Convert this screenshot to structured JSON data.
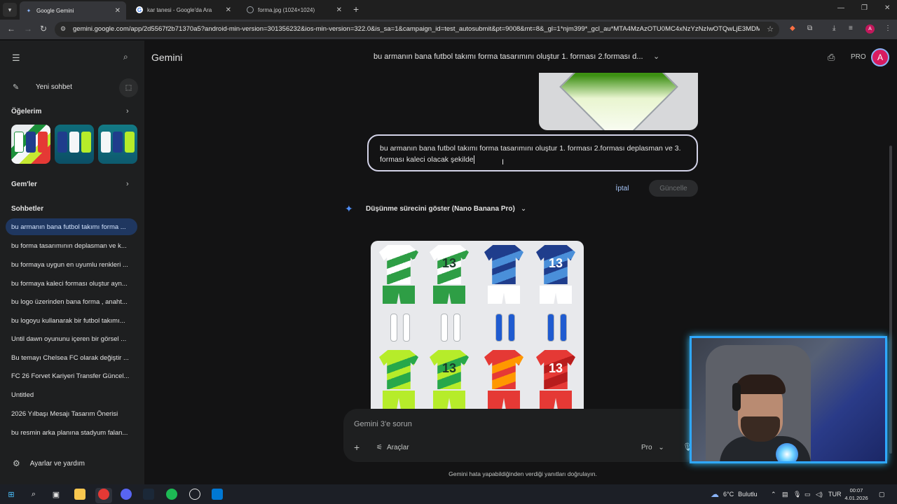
{
  "browser": {
    "tabs": [
      {
        "title": "Google Gemini",
        "active": true,
        "icon": "gemini-icon"
      },
      {
        "title": "kar tanesi - Google'da Ara",
        "active": false,
        "icon": "google-icon"
      },
      {
        "title": "forma.jpg (1024×1024)",
        "active": false,
        "icon": "globe-icon"
      }
    ],
    "url": "gemini.google.com/app/2d5567f2b71370a5?android-min-version=301356232&ios-min-version=322.0&is_sa=1&campaign_id=test_autosubmit&pt=9008&mt=8&_gl=1*njm399*_gcl_au*MTA4MzAzOTU0MC4xNzYzNzIwOTQwLjE3MDM5...",
    "profile_initial": "A"
  },
  "sidebar": {
    "new_chat_label": "Yeni sohbet",
    "items_heading": "Öğelerim",
    "gems_heading": "Gem'ler",
    "chats_heading": "Sohbetler",
    "chats": [
      "bu armanın bana futbol takımı forma ...",
      "bu forma tasarımının deplasman ve k...",
      "bu formaya uygun en uyumlu renkleri ...",
      "bu formaya kaleci forması oluştur ayn...",
      "bu logo üzerinden bana forma , anaht...",
      "bu logoyu kullanarak bir futbol takımı...",
      "Until dawn oyununu içeren bir görsel ...",
      "Bu temayı Chelsea FC olarak değiştir ...",
      "FC 26 Forvet Kariyeri Transfer Güncel...",
      "Untitled",
      "2026 Yılbaşı Mesajı Tasarım Önerisi",
      "bu resmin arka planına stadyum falan..."
    ],
    "settings_label": "Ayarlar ve yardım"
  },
  "header": {
    "brand": "Gemini",
    "conversation_title": "bu armanın bana futbol takımı forma tasarımını oluştur 1. forması 2.forması d...",
    "plan_label": "PRO",
    "avatar_initial": "A"
  },
  "edit": {
    "text": "bu armanın bana futbol takımı forma tasarımını oluştur 1. forması 2.forması deplasman ve 3. forması kaleci olacak şekilde",
    "cancel_label": "İptal",
    "update_label": "Güncelle"
  },
  "response": {
    "thinking_label": "Düşünme sürecini göster (Nano Banana Pro)",
    "kit_number": "13",
    "kits": [
      {
        "shirt": "#ffffff",
        "pattern": "#2e9e45",
        "num_color": "#1b6b2c",
        "shorts": "#2e9e45"
      },
      {
        "shirt": "#ffffff",
        "pattern": "#2e9e45",
        "num_color": "#1b3b2a",
        "shorts": "#2e9e45"
      },
      {
        "shirt": "#1f3d8c",
        "pattern": "#4a8fd9",
        "num_color": "#ffffff",
        "shorts": "#ffffff"
      },
      {
        "shirt": "#1f3d8c",
        "pattern": "#4a8fd9",
        "num_color": "#ffffff",
        "shorts": "#ffffff"
      },
      {
        "shirt": "#b6ec2a",
        "pattern": "#27a84a",
        "num_color": "#1b3b2a",
        "shorts": "#b6ec2a"
      },
      {
        "shirt": "#b6ec2a",
        "pattern": "#27a84a",
        "num_color": "#1b3b2a",
        "shorts": "#b6ec2a"
      },
      {
        "shirt": "#e53935",
        "pattern": "#ff9800",
        "num_color": "#ffffff",
        "shorts": "#e53935"
      },
      {
        "shirt": "#e53935",
        "pattern": "#b71c1c",
        "num_color": "#ffffff",
        "shorts": "#e53935"
      }
    ]
  },
  "composer": {
    "placeholder": "Gemini 3'e sorun",
    "tools_label": "Araçlar",
    "model_label": "Pro",
    "disclaimer": "Gemini hata yapabildiğinden verdiği yanıtları doğrulayın."
  },
  "taskbar": {
    "temperature": "6°C",
    "condition": "Bulutlu",
    "language": "TUR",
    "time": "00:07",
    "date": "4.01.2026"
  },
  "colors": {
    "accent": "#a8c7fa",
    "active_chat_bg": "#1f3760",
    "background": "#131314",
    "sidebar_bg": "#1e1f20"
  }
}
